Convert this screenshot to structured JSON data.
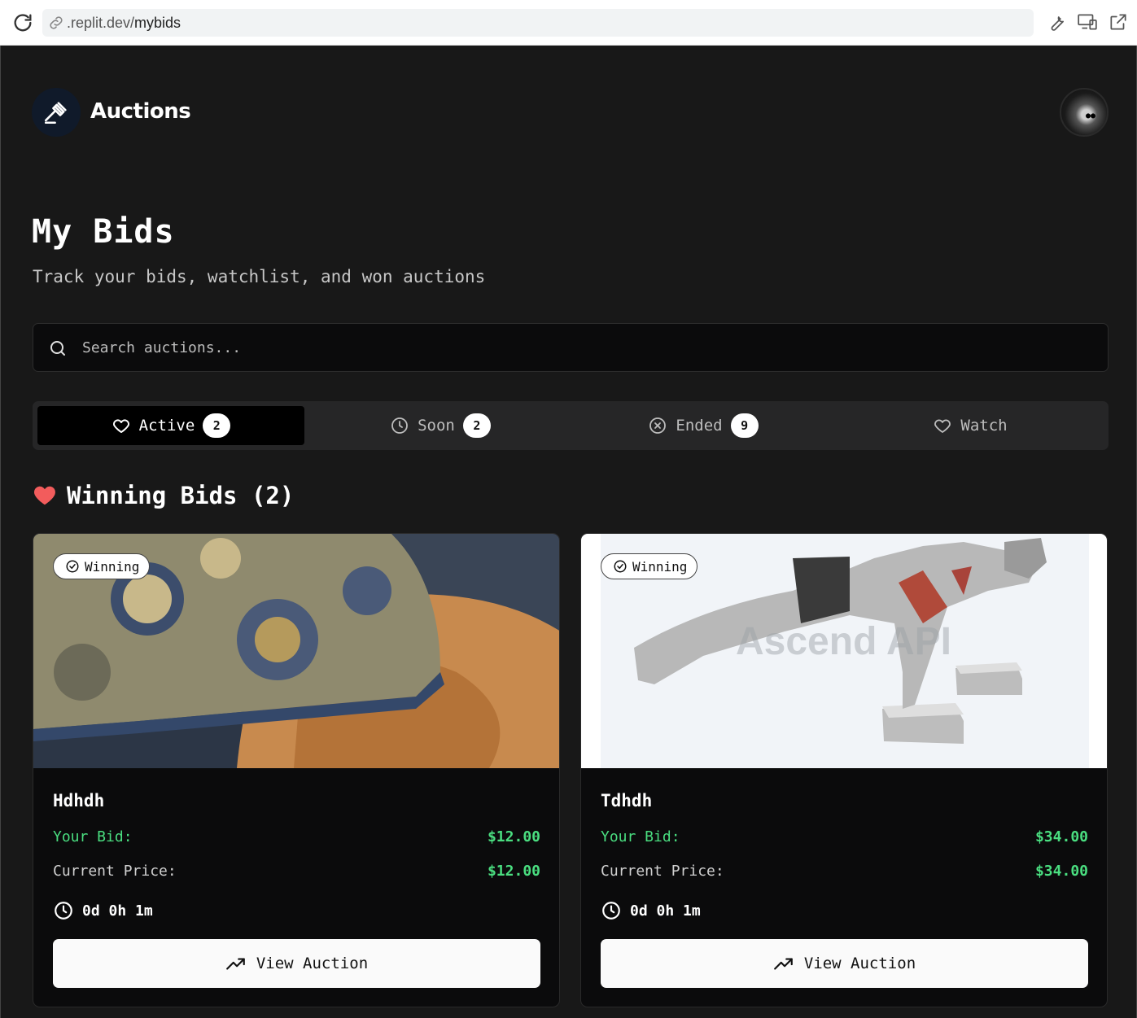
{
  "browser": {
    "url_prefix": ".replit.dev/",
    "url_path": "mybids"
  },
  "header": {
    "brand": "Auctions"
  },
  "page": {
    "title": "My Bids",
    "subtitle": "Track your bids, watchlist, and won auctions"
  },
  "search": {
    "placeholder": "Search auctions..."
  },
  "tabs": [
    {
      "label": "Active",
      "count": "2",
      "icon": "heart-icon"
    },
    {
      "label": "Soon",
      "count": "2",
      "icon": "clock-icon"
    },
    {
      "label": "Ended",
      "count": "9",
      "icon": "x-circle-icon"
    },
    {
      "label": "Watch",
      "icon": "heart-icon"
    }
  ],
  "section": {
    "title": "Winning Bids (2)"
  },
  "cards": [
    {
      "badge": "Winning",
      "name": "Hdhdh",
      "your_bid_label": "Your Bid:",
      "your_bid": "$12.00",
      "current_price_label": "Current Price:",
      "current_price": "$12.00",
      "time_left": "0d 0h 1m",
      "button": "View Auction"
    },
    {
      "badge": "Winning",
      "name": "Tdhdh",
      "your_bid_label": "Your Bid:",
      "your_bid": "$34.00",
      "current_price_label": "Current Price:",
      "current_price": "$34.00",
      "time_left": "0d 0h 1m",
      "button": "View Auction",
      "image_watermark": "Ascend API"
    }
  ],
  "colors": {
    "background": "#181818",
    "card": "#0b0b0c",
    "accent_green": "#4ade80",
    "heart_red": "#f25c5c"
  }
}
